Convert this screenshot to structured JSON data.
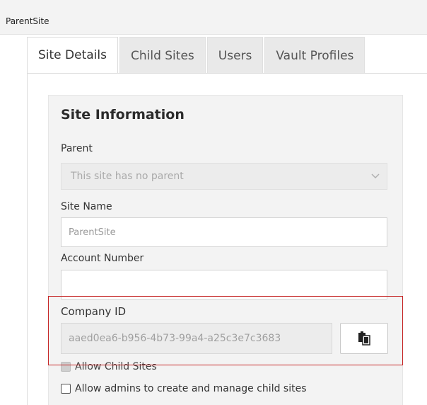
{
  "window": {
    "title": "ParentSite"
  },
  "tabs": [
    {
      "label": "Site Details",
      "active": true
    },
    {
      "label": "Child Sites",
      "active": false
    },
    {
      "label": "Users",
      "active": false
    },
    {
      "label": "Vault Profiles",
      "active": false
    }
  ],
  "site_info": {
    "heading": "Site Information",
    "parent_label": "Parent",
    "parent_select_value": "This site has no parent",
    "site_name_label": "Site Name",
    "site_name_value": "ParentSite",
    "account_number_label": "Account Number",
    "account_number_value": "",
    "company_id_label": "Company ID",
    "company_id_value": "aaed0ea6-b956-4b73-99a4-a25c3e7c3683",
    "allow_child_sites_label": "Allow Child Sites",
    "allow_admins_label": "Allow admins to create and manage child sites"
  },
  "icons": {
    "copy": "clipboard-copy-icon",
    "dropdown": "chevron-down-icon"
  },
  "colors": {
    "highlight": "#c62828"
  }
}
